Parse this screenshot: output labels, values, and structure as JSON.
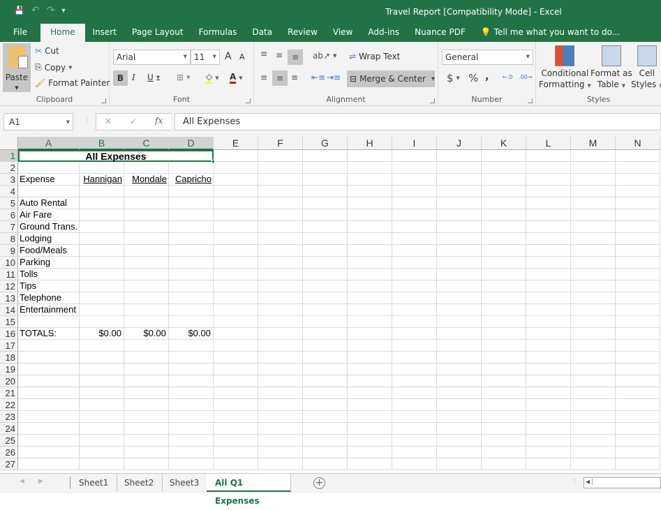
{
  "app": {
    "title": "Travel Report  [Compatibility Mode] - Excel"
  },
  "qat": {
    "save": "💾",
    "undo": "↶",
    "redo": "↷",
    "customize": "▾"
  },
  "ribbon_tabs": [
    "File",
    "Home",
    "Insert",
    "Page Layout",
    "Formulas",
    "Data",
    "Review",
    "View",
    "Add-ins",
    "Nuance PDF"
  ],
  "tell_me": "Tell me what you want to do...",
  "clipboard": {
    "paste": "Paste",
    "cut": "Cut",
    "copy": "Copy",
    "format_painter": "Format Painter",
    "label": "Clipboard"
  },
  "font": {
    "name": "Arial",
    "size": "11",
    "label": "Font",
    "bold": "B",
    "italic": "I",
    "underline": "U",
    "grow": "A",
    "shrink": "A"
  },
  "alignment": {
    "wrap_text": "Wrap Text",
    "merge_center": "Merge & Center",
    "label": "Alignment"
  },
  "number": {
    "format": "General",
    "currency": "$",
    "percent": "%",
    "comma": ",",
    "label": "Number",
    "inc_decimal": "←.0",
    "dec_decimal": ".00→"
  },
  "styles": {
    "conditional": "Conditional",
    "conditional2": "Formatting",
    "format_table": "Format as",
    "format_table2": "Table",
    "cell_styles": "Cell",
    "cell_styles2": "Styles",
    "label": "Styles"
  },
  "formula_bar": {
    "name_box": "A1",
    "cancel": "✕",
    "enter": "✓",
    "fx": "fx",
    "value": "All Expenses"
  },
  "columns": [
    "A",
    "B",
    "C",
    "D",
    "E",
    "F",
    "G",
    "H",
    "I",
    "J",
    "K",
    "L",
    "M",
    "N"
  ],
  "rows": [
    "1",
    "2",
    "3",
    "4",
    "5",
    "6",
    "7",
    "8",
    "9",
    "10",
    "11",
    "12",
    "13",
    "14",
    "15",
    "16",
    "17",
    "18",
    "19",
    "20",
    "21",
    "22",
    "23",
    "24",
    "25",
    "26",
    "27"
  ],
  "cells": {
    "title": "All Expenses",
    "header": {
      "expense": "Expense",
      "b": "Hannigan",
      "c": "Mondale",
      "d": "Capricho"
    },
    "expenses": [
      "Auto Rental",
      "Air Fare",
      "Ground Trans.",
      "Lodging",
      "Food/Meals",
      "Parking",
      "Tolls",
      "Tips",
      "Telephone",
      "Entertainment"
    ],
    "totals_label": "TOTALS:",
    "totals": [
      "$0.00",
      "$0.00",
      "$0.00"
    ]
  },
  "sheets": [
    "Sheet1",
    "Sheet2",
    "Sheet3",
    "All Q1 Expenses"
  ],
  "active_sheet": "All Q1 Expenses",
  "colors": {
    "accent": "#217346"
  }
}
